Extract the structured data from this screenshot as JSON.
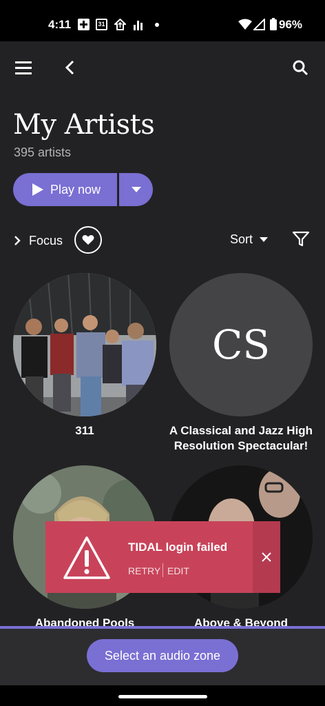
{
  "status_bar": {
    "time": "4:11",
    "battery": "96%",
    "icons": [
      "hospital-cross-icon",
      "calendar-icon",
      "home-upload-icon",
      "signal-bars-icon",
      "dot-icon",
      "wifi-icon",
      "cell-signal-icon",
      "battery-icon"
    ],
    "calendar_day": "31"
  },
  "header": {
    "icons": [
      "menu-icon",
      "back-icon",
      "search-icon"
    ],
    "title": "My Artists",
    "count": "395 artists"
  },
  "actions": {
    "play_label": "Play now",
    "focus_label": "Focus",
    "sort_label": "Sort"
  },
  "artists": [
    {
      "name": "311"
    },
    {
      "name": "A Classical and Jazz High Resolution Spectacular!",
      "monogram": "CS"
    },
    {
      "name": "Abandoned Pools"
    },
    {
      "name": "Above & Beyond"
    }
  ],
  "toast": {
    "title": "TIDAL login failed",
    "retry": "RETRY",
    "edit": "EDIT"
  },
  "bottom": {
    "zone_button": "Select an audio zone"
  },
  "colors": {
    "accent": "#7a6fd3",
    "background": "#222224",
    "toast": "#c8435a"
  }
}
